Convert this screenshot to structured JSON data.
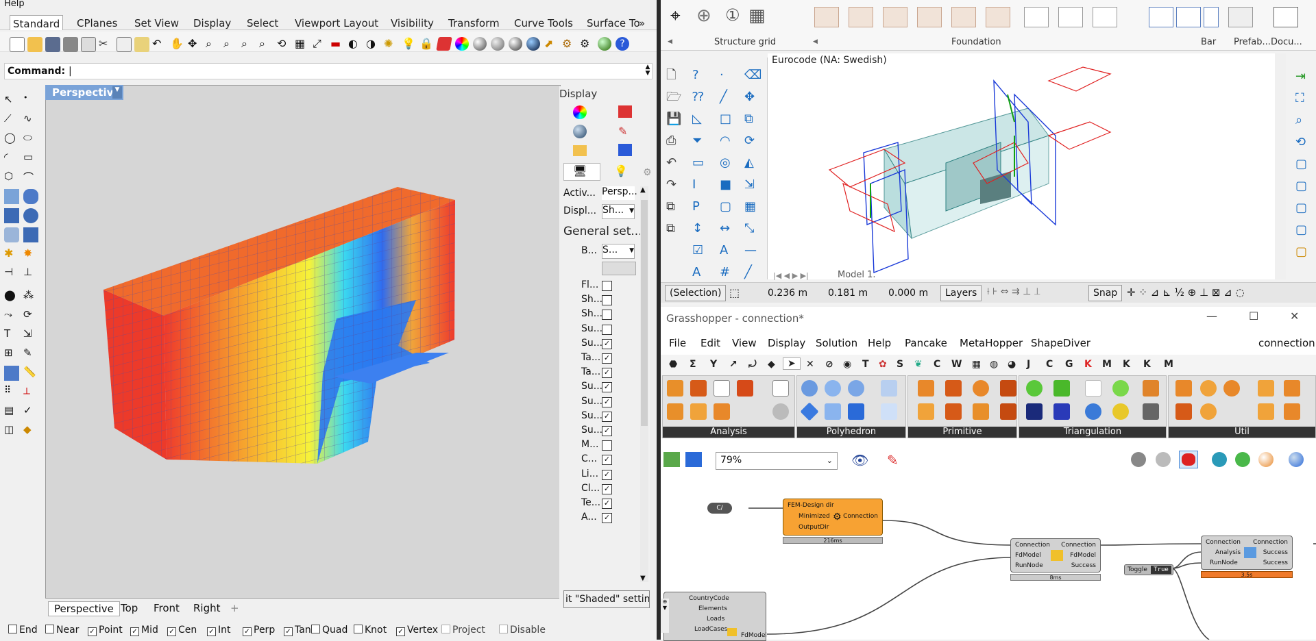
{
  "rhino": {
    "menu_partial": "Help",
    "tabs": [
      "Standard",
      "CPlanes",
      "Set View",
      "Display",
      "Select",
      "Viewport Layout",
      "Visibility",
      "Transform",
      "Curve Tools",
      "Surface To"
    ],
    "command_label": "Command:",
    "viewport": {
      "name": "Perspective"
    },
    "display_panel": {
      "title": "Display",
      "active_label": "Activ...",
      "active_value": "Persp...",
      "display_label": "Displ...",
      "display_value": "Sh...",
      "section": "General set...",
      "b_label": "B...",
      "b_value": "S...",
      "settings": [
        {
          "label": "Fl...",
          "checked": false
        },
        {
          "label": "Sh...",
          "checked": false
        },
        {
          "label": "Sh...",
          "checked": false
        },
        {
          "label": "Su...",
          "checked": false
        },
        {
          "label": "Su...",
          "checked": true
        },
        {
          "label": "Ta...",
          "checked": true
        },
        {
          "label": "Ta...",
          "checked": true
        },
        {
          "label": "Su...",
          "checked": true
        },
        {
          "label": "Su...",
          "checked": true
        },
        {
          "label": "Su...",
          "checked": true
        },
        {
          "label": "Su...",
          "checked": true
        },
        {
          "label": "M...",
          "checked": false
        },
        {
          "label": "C...",
          "checked": true
        },
        {
          "label": "Li...",
          "checked": true
        },
        {
          "label": "Cl...",
          "checked": true
        },
        {
          "label": "Te...",
          "checked": true
        },
        {
          "label": "A...",
          "checked": true
        }
      ],
      "footer": "it \"Shaded\" setting"
    },
    "view_tabs": [
      "Perspective",
      "Top",
      "Front",
      "Right"
    ],
    "osnaps": [
      {
        "label": "End",
        "checked": false
      },
      {
        "label": "Near",
        "checked": false
      },
      {
        "label": "Point",
        "checked": true
      },
      {
        "label": "Mid",
        "checked": true
      },
      {
        "label": "Cen",
        "checked": true
      },
      {
        "label": "Int",
        "checked": true
      },
      {
        "label": "Perp",
        "checked": true
      },
      {
        "label": "Tan",
        "checked": true
      },
      {
        "label": "Quad",
        "checked": false
      },
      {
        "label": "Knot",
        "checked": false
      },
      {
        "label": "Vertex",
        "checked": true
      },
      {
        "label": "Project",
        "checked": false
      },
      {
        "label": "Disable",
        "checked": false
      }
    ]
  },
  "fem": {
    "groups": [
      "Structure grid",
      "Foundation",
      "Bar",
      "Prefab...",
      "Docu..."
    ],
    "canvas_title": "Eurocode (NA: Swedish)",
    "model_tab": "Model 1.",
    "status": {
      "selection": "(Selection)",
      "x": "0.236 m",
      "y": "0.181 m",
      "z": "0.000 m",
      "layers": "Layers",
      "snap": "Snap"
    }
  },
  "gh": {
    "title": "Grasshopper - connection*",
    "menu": [
      "File",
      "Edit",
      "View",
      "Display",
      "Solution",
      "Help",
      "Pancake",
      "MetaHopper",
      "ShapeDiver"
    ],
    "doc_name": "connection",
    "tab_letters": [
      "T",
      "S",
      "C",
      "W",
      "J",
      "C",
      "G",
      "K",
      "M",
      "K",
      "K",
      "M"
    ],
    "panels": [
      "Analysis",
      "Polyhedron",
      "Primitive",
      "Triangulation",
      "Util"
    ],
    "zoom": "79%",
    "components": {
      "c1": {
        "in": [
          "FEM-Design dir",
          "Minimized",
          "OutputDir"
        ],
        "out": [
          "Connection"
        ],
        "time": "216ms"
      },
      "c2": {
        "in": [
          "Connection",
          "FdModel",
          "RunNode"
        ],
        "out": [
          "Connection",
          "FdModel",
          "Success"
        ],
        "time": "8ms"
      },
      "c3": {
        "in": [
          "Connection",
          "Analysis",
          "RunNode"
        ],
        "out": [
          "Connection",
          "Success",
          "Success"
        ],
        "time": "3.5s"
      },
      "c4": {
        "in": [
          "CountryCode",
          "Elements",
          "Loads",
          "LoadCases"
        ],
        "out": [
          "FdModel"
        ]
      },
      "toggle": {
        "label": "Toggle",
        "value": "True"
      }
    }
  }
}
